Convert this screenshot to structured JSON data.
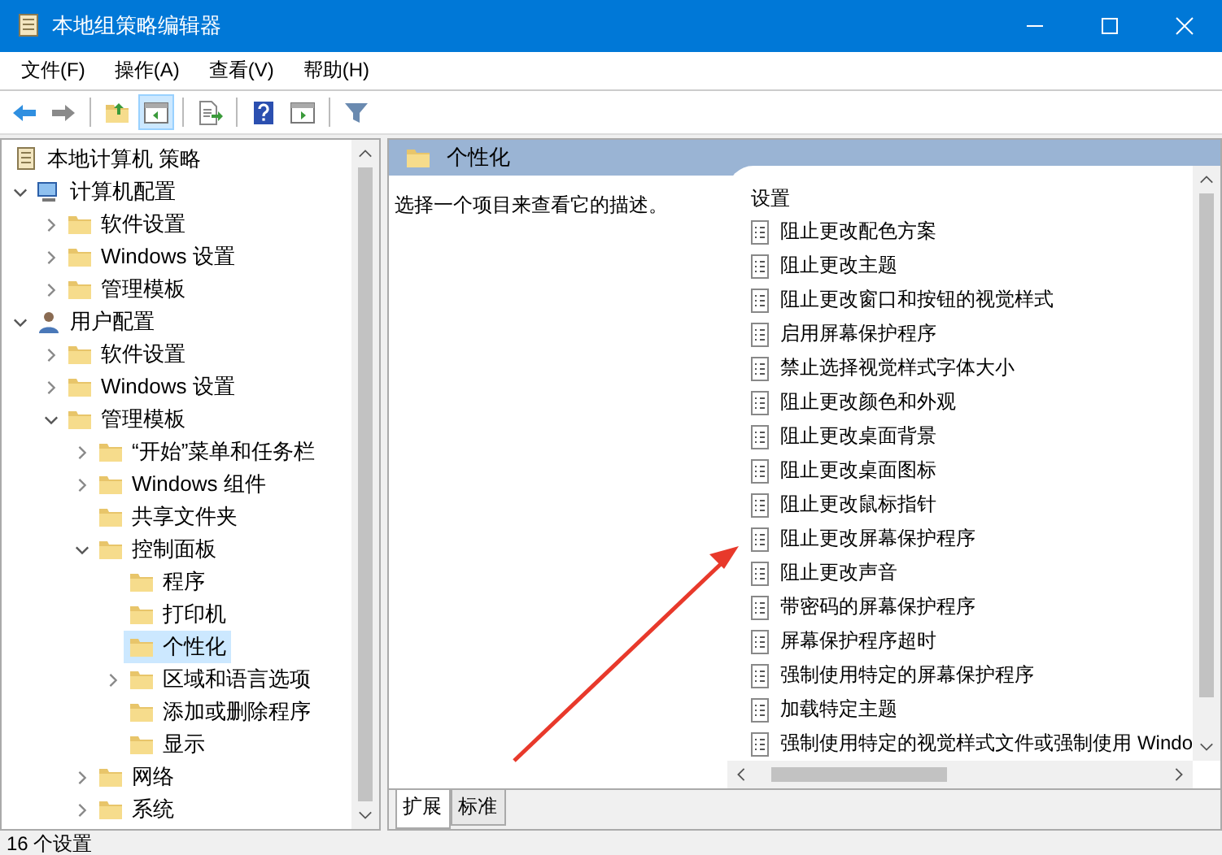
{
  "window": {
    "title": "本地组策略编辑器"
  },
  "menu": [
    "文件(F)",
    "操作(A)",
    "查看(V)",
    "帮助(H)"
  ],
  "toolbar": [
    [
      {
        "kind": "back",
        "pressed": false
      },
      {
        "kind": "forward",
        "pressed": false
      }
    ],
    [
      {
        "kind": "up",
        "pressed": false
      },
      {
        "kind": "tree",
        "pressed": true
      }
    ],
    [
      {
        "kind": "export",
        "pressed": false
      }
    ],
    [
      {
        "kind": "help",
        "pressed": false
      },
      {
        "kind": "pane",
        "pressed": false
      }
    ],
    [
      {
        "kind": "filter",
        "pressed": false
      }
    ]
  ],
  "tree": {
    "label": "本地计算机 策略",
    "children": [
      {
        "label": "计算机配置",
        "kind": "computer",
        "expanded": true,
        "selected": false,
        "children": [
          {
            "label": "软件设置",
            "kind": "folder",
            "expanded": false,
            "selected": false
          },
          {
            "label": "Windows 设置",
            "kind": "folder",
            "expanded": false,
            "selected": false
          },
          {
            "label": "管理模板",
            "kind": "folder",
            "expanded": false,
            "selected": false
          }
        ]
      },
      {
        "label": "用户配置",
        "kind": "user",
        "expanded": true,
        "selected": false,
        "children": [
          {
            "label": "软件设置",
            "kind": "folder",
            "expanded": false,
            "selected": false
          },
          {
            "label": "Windows 设置",
            "kind": "folder",
            "expanded": false,
            "selected": false
          },
          {
            "label": "管理模板",
            "kind": "folder",
            "expanded": true,
            "selected": false,
            "children": [
              {
                "label": "“开始”菜单和任务栏",
                "kind": "folder",
                "expanded": false,
                "selected": false
              },
              {
                "label": "Windows 组件",
                "kind": "folder",
                "expanded": false,
                "selected": false
              },
              {
                "label": "共享文件夹",
                "kind": "leaf",
                "selected": false
              },
              {
                "label": "控制面板",
                "kind": "folder",
                "expanded": true,
                "selected": false,
                "children": [
                  {
                    "label": "程序",
                    "kind": "leaf",
                    "selected": false
                  },
                  {
                    "label": "打印机",
                    "kind": "leaf",
                    "selected": false
                  },
                  {
                    "label": "个性化",
                    "kind": "leaf",
                    "selected": true
                  },
                  {
                    "label": "区域和语言选项",
                    "kind": "folder",
                    "expanded": false,
                    "selected": false
                  },
                  {
                    "label": "添加或删除程序",
                    "kind": "leaf",
                    "selected": false
                  },
                  {
                    "label": "显示",
                    "kind": "leaf",
                    "selected": false
                  }
                ]
              },
              {
                "label": "网络",
                "kind": "folder",
                "expanded": false,
                "selected": false
              },
              {
                "label": "系统",
                "kind": "folder",
                "expanded": false,
                "selected": false
              }
            ]
          }
        ]
      }
    ]
  },
  "details": {
    "title": "个性化",
    "description": "选择一个项目来查看它的描述。",
    "column": "设置",
    "settings": [
      "阻止更改配色方案",
      "阻止更改主题",
      "阻止更改窗口和按钮的视觉样式",
      "启用屏幕保护程序",
      "禁止选择视觉样式字体大小",
      "阻止更改颜色和外观",
      "阻止更改桌面背景",
      "阻止更改桌面图标",
      "阻止更改鼠标指针",
      "阻止更改屏幕保护程序",
      "阻止更改声音",
      "带密码的屏幕保护程序",
      "屏幕保护程序超时",
      "强制使用特定的屏幕保护程序",
      "加载特定主题",
      "强制使用特定的视觉样式文件或强制使用 Windo"
    ],
    "tabs": [
      {
        "label": "扩展",
        "selected": true
      },
      {
        "label": "标准",
        "selected": false
      }
    ]
  },
  "status_bar": "16 个设置"
}
